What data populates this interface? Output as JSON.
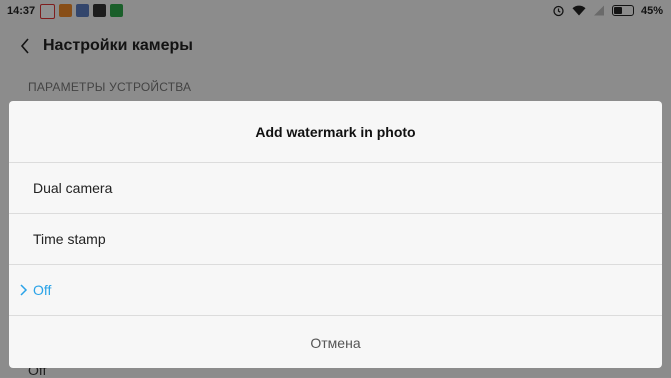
{
  "status_bar": {
    "time": "14:37",
    "battery": "45%",
    "battery_level": 0.45
  },
  "app_bar": {
    "title": "Настройки камеры"
  },
  "settings": {
    "section_header": "ПАРАМЕТРЫ УСТРОЙСТВА",
    "peek_text": "Off"
  },
  "dialog": {
    "title": "Add watermark in photo",
    "options": [
      {
        "label": "Dual camera"
      },
      {
        "label": "Time stamp"
      },
      {
        "label": "Off",
        "selected": true
      }
    ],
    "cancel": "Отмена"
  },
  "colors": {
    "accent": "#2aa3e8",
    "notif_icons": [
      "#f2c200",
      "#f08a2a",
      "#5a7bbf",
      "#333333",
      "#2ea84a"
    ]
  }
}
